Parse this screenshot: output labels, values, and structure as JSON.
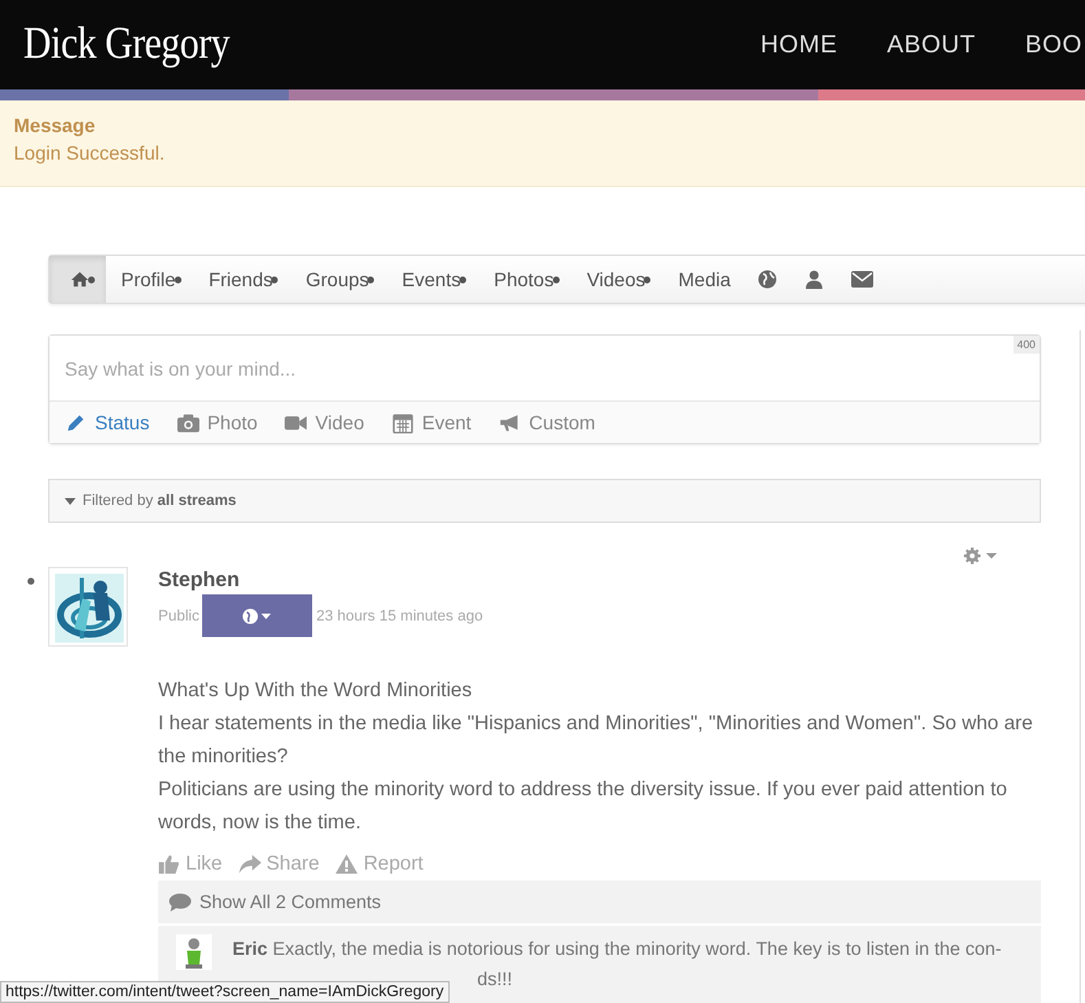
{
  "header": {
    "site_title": "Dick Gregory",
    "nav": [
      {
        "label": "HOME"
      },
      {
        "label": "ABOUT"
      },
      {
        "label": "BOO"
      }
    ]
  },
  "message": {
    "title": "Message",
    "text": "Login Successful."
  },
  "profile_nav": {
    "items": [
      {
        "kind": "home",
        "dot": true,
        "selected": true
      },
      {
        "kind": "text",
        "label": "Profile",
        "dot": true,
        "selected": false
      },
      {
        "kind": "text",
        "label": "Friends",
        "dot": true,
        "selected": false
      },
      {
        "kind": "text",
        "label": "Groups",
        "dot": true,
        "selected": false
      },
      {
        "kind": "text",
        "label": "Events",
        "dot": true,
        "selected": false
      },
      {
        "kind": "text",
        "label": "Photos",
        "dot": true,
        "selected": false
      },
      {
        "kind": "text",
        "label": "Videos",
        "dot": true,
        "selected": false
      },
      {
        "kind": "text",
        "label": "Media",
        "dot": false,
        "selected": false
      },
      {
        "kind": "globe",
        "dot": false,
        "selected": false
      },
      {
        "kind": "user",
        "dot": false,
        "selected": false
      },
      {
        "kind": "mail",
        "dot": false,
        "selected": false
      }
    ]
  },
  "composer": {
    "placeholder": "Say what is on your mind...",
    "char_count": "400",
    "tabs": [
      {
        "kind": "status",
        "label": "Status",
        "selected": true
      },
      {
        "label": "Photo",
        "selected": false
      },
      {
        "kind": "video",
        "label": "Video",
        "selected": false
      },
      {
        "kind": "event",
        "label": "Event",
        "selected": false
      },
      {
        "kind": "custom",
        "label": "Custom",
        "selected": false
      }
    ]
  },
  "filter": {
    "prefix": "Filtered by",
    "value": "all streams"
  },
  "post": {
    "author": "Stephen",
    "privacy": "Public",
    "time": "23 hours 15 minutes ago",
    "lines": [
      "What's Up With the Word Minorities",
      "I hear statements in the media like \"Hispanics and Minorities\", \"Minorities and Women\". So who are the minorities?",
      "Politicians are using the minority word to address the diversity issue. If you ever paid attention to words, now is the time."
    ],
    "actions": [
      {
        "kind": "like",
        "label": "Like"
      },
      {
        "kind": "share",
        "label": "Share"
      },
      {
        "kind": "report",
        "label": "Report"
      }
    ],
    "show_comments": "Show All 2 Comments",
    "comment": {
      "author": "Eric",
      "text": "Exactly, the media is notorious for using the minority word. The key is to listen in the con-",
      "text_tail": "ds!!!"
    }
  },
  "status_link": "https://twitter.com/intent/tweet?screen_name=IAmDickGregory"
}
